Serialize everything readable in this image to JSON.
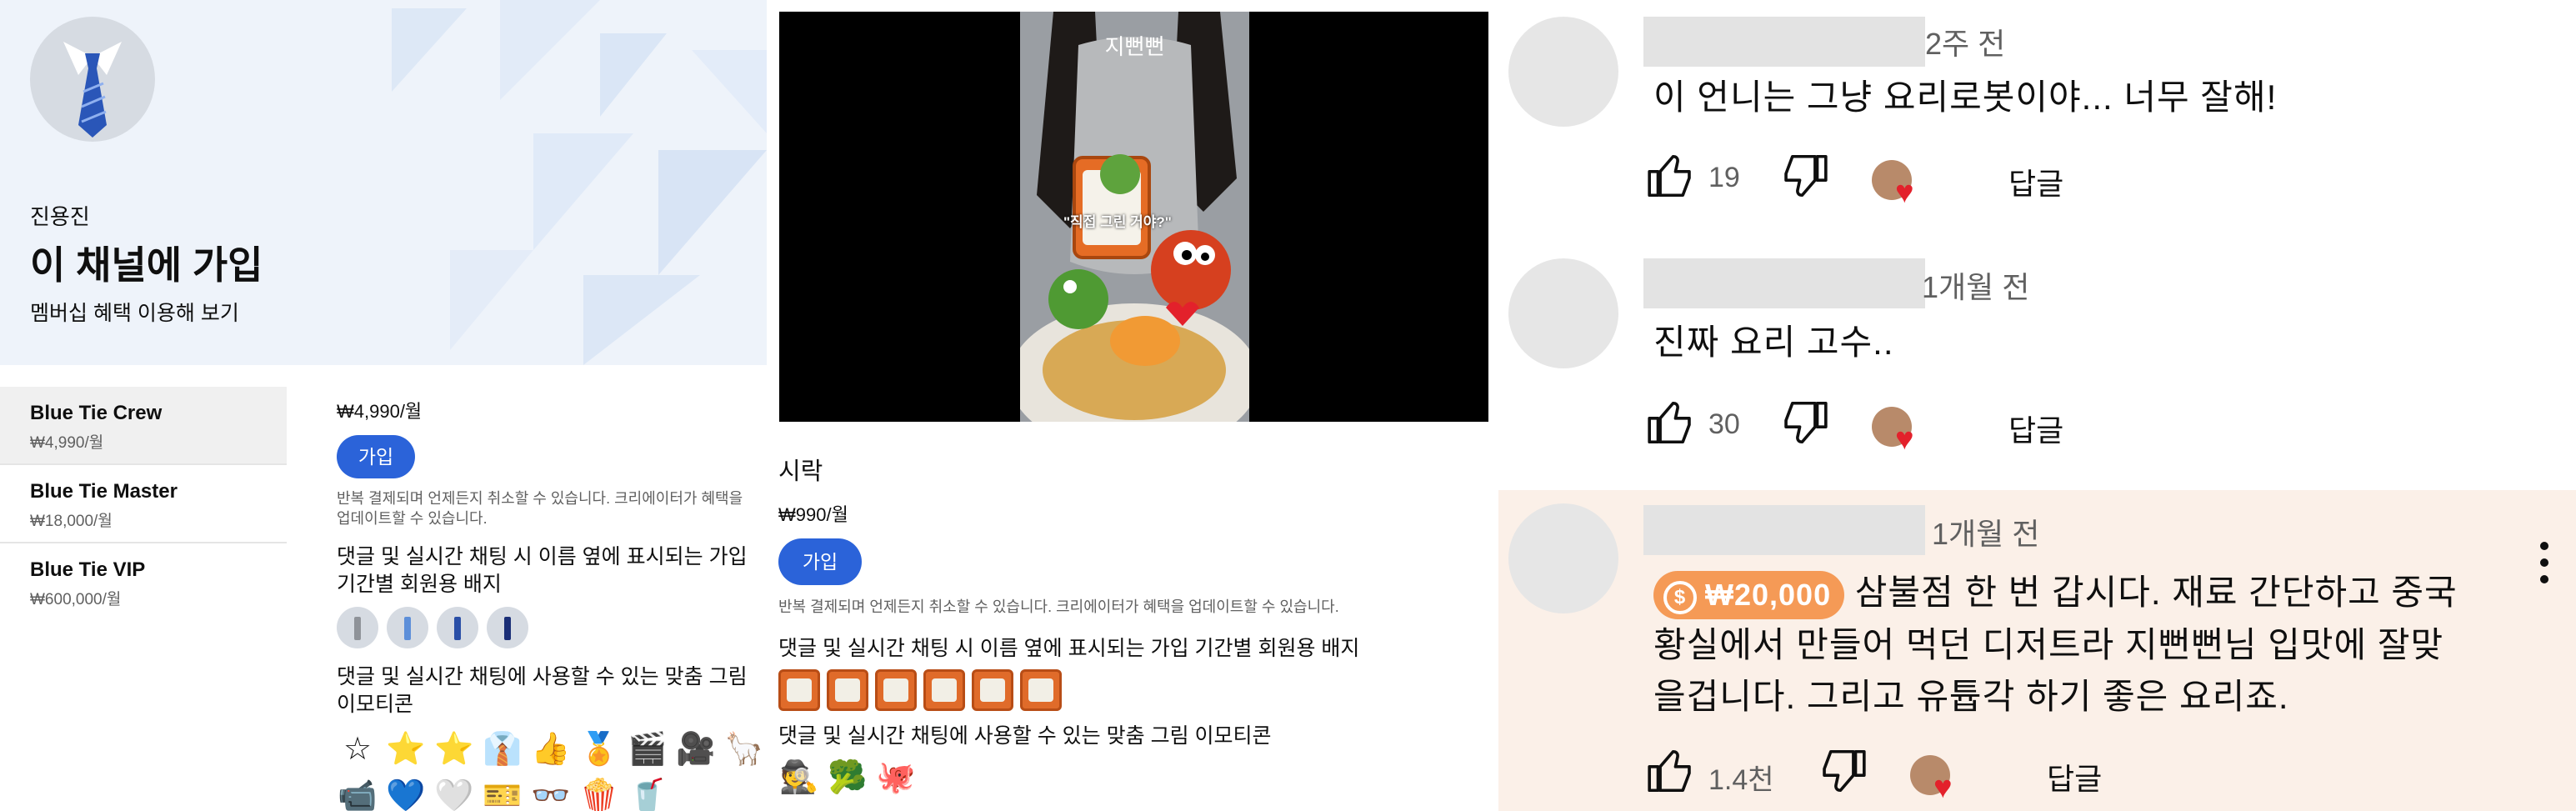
{
  "join_panel": {
    "channel_owner": "진용진",
    "title": "이 채널에 가입",
    "subtitle": "멤버십 혜택 이용해 보기",
    "tiers": [
      {
        "name": "Blue Tie Crew",
        "price": "₩4,990/월"
      },
      {
        "name": "Blue Tie Master",
        "price": "₩18,000/월"
      },
      {
        "name": "Blue Tie VIP",
        "price": "₩600,000/월"
      }
    ],
    "detail": {
      "price": "₩4,990/월",
      "join_label": "가입",
      "note": "반복 결제되며 언제든지 취소할 수 있습니다. 크리에이터가 혜택을 업데이트할 수 있습니다.",
      "perk_badges": "댓글 및 실시간 채팅 시 이름 옆에 표시되는 가입 기간별 회원용 배지",
      "perk_emotes": "댓글 및 실시간 채팅에 사용할 수 있는 맞춤 그림 이모티콘"
    }
  },
  "video_panel": {
    "video_caption": "지뻔뻔",
    "video_speech": "\"직접 그린 거야?\"",
    "level_name": "시락",
    "price": "₩990/월",
    "join_label": "가입",
    "note": "반복 결제되며 언제든지 취소할 수 있습니다. 크리에이터가 혜택을 업데이트할 수 있습니다.",
    "perk_badges": "댓글 및 실시간 채팅 시 이름 옆에 표시되는 가입 기간별 회원용 배지",
    "perk_emotes": "댓글 및 실시간 채팅에 사용할 수 있는 맞춤 그림 이모티콘"
  },
  "comments": [
    {
      "time": "2주 전",
      "text": "이 언니는 그냥 요리로봇이야... 너무 잘해!",
      "likes": "19",
      "reply": "답글"
    },
    {
      "time": "1개월 전",
      "text": "진짜 요리 고수..",
      "likes": "30",
      "reply": "답글"
    },
    {
      "time": "1개월 전",
      "super_thanks": "₩20,000",
      "coin": "$",
      "text_lines": [
        "삼불점 한 번 갑시다. 재료 간단하고 중국",
        "황실에서 만들어 먹던 디저트라 지뻔뻔님 입맛에 잘맞",
        "을겁니다. 그리고 유튭각 하기 좋은 요리죠."
      ],
      "likes": "1.4천",
      "reply": "답글"
    }
  ],
  "emotes_grid": [
    "☆",
    "⭐",
    "⭐",
    "👔",
    "👍",
    "🏅",
    "🎬",
    "🎥",
    "🦙",
    "📹",
    "💙",
    "🤍",
    "🎫",
    "👓",
    "🍿",
    "🥤"
  ],
  "emotes_row": [
    "🕵",
    "🥦",
    "🐙"
  ],
  "icons": {
    "like": "thumbs-up-icon",
    "dislike": "thumbs-down-icon",
    "menu": "more-vert-icon",
    "coin": "dollar-coin-icon"
  },
  "colors": {
    "accent_blue": "#2b63d9",
    "super_thanks": "#f59a56",
    "highlight_bg": "#fbf0e8",
    "hero_bg": "#eef3fa"
  }
}
